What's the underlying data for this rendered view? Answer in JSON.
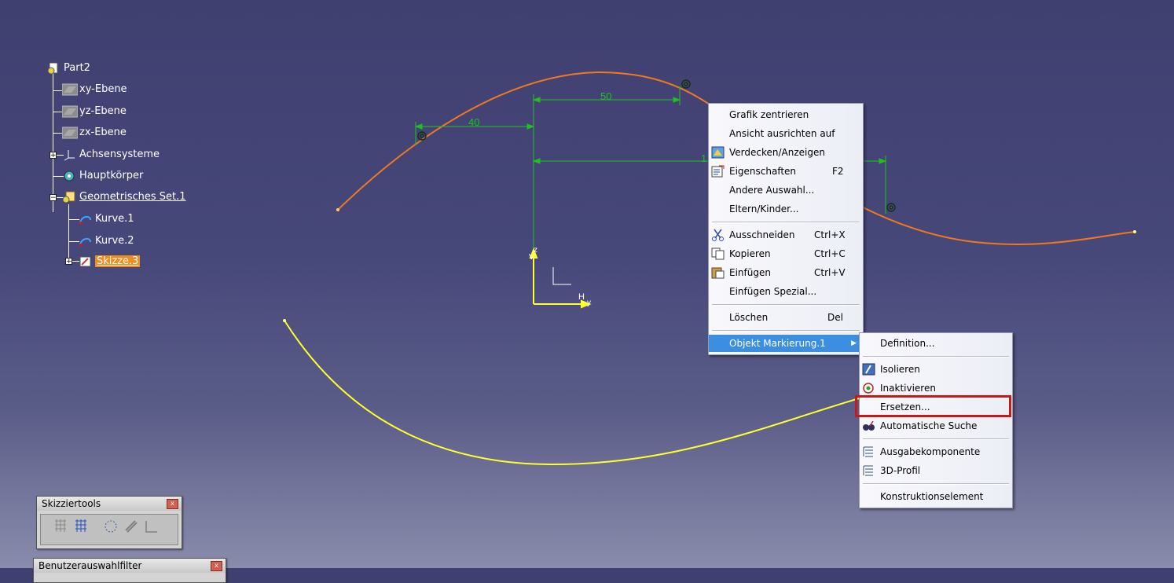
{
  "tree": {
    "root": "Part2",
    "items": [
      {
        "label": "xy-Ebene",
        "icon": "plane-icon"
      },
      {
        "label": "yz-Ebene",
        "icon": "plane-icon"
      },
      {
        "label": "zx-Ebene",
        "icon": "plane-icon"
      },
      {
        "label": "Achsensysteme",
        "icon": "axis-system-icon"
      },
      {
        "label": "Hauptkörper",
        "icon": "body-gear-icon"
      },
      {
        "label": "Geometrisches Set.1",
        "icon": "geometrical-set-icon"
      },
      {
        "label": "Kurve.1",
        "icon": "curve-icon"
      },
      {
        "label": "Kurve.2",
        "icon": "curve-icon"
      },
      {
        "label": "Skizze.3",
        "icon": "sketch-icon"
      }
    ]
  },
  "sketch": {
    "dim_40": "40",
    "dim_50": "50",
    "dim_1": "1",
    "axis_v": "V",
    "axis_z": "z",
    "axis_h": "H",
    "axis_y": "y"
  },
  "context_menu": {
    "items": [
      {
        "label": "Grafik zentrieren",
        "shortcut": ""
      },
      {
        "label": "Ansicht ausrichten auf",
        "shortcut": ""
      },
      {
        "label": "Verdecken/Anzeigen",
        "shortcut": ""
      },
      {
        "label": "Eigenschaften",
        "shortcut": "F2"
      },
      {
        "label": "Andere Auswahl...",
        "shortcut": ""
      },
      {
        "label": "Eltern/Kinder...",
        "shortcut": ""
      },
      {
        "label": "Ausschneiden",
        "shortcut": "Ctrl+X"
      },
      {
        "label": "Kopieren",
        "shortcut": "Ctrl+C"
      },
      {
        "label": "Einfügen",
        "shortcut": "Ctrl+V"
      },
      {
        "label": "Einfügen Spezial...",
        "shortcut": ""
      },
      {
        "label": "Löschen",
        "shortcut": "Del"
      },
      {
        "label": "Objekt Markierung.1",
        "shortcut": ""
      }
    ]
  },
  "submenu": {
    "items": [
      {
        "label": "Definition..."
      },
      {
        "label": "Isolieren"
      },
      {
        "label": "Inaktivieren"
      },
      {
        "label": "Ersetzen..."
      },
      {
        "label": "Automatische Suche"
      },
      {
        "label": "Ausgabekomponente"
      },
      {
        "label": "3D-Profil"
      },
      {
        "label": "Konstruktionselement"
      }
    ]
  },
  "toolbar_sketch": {
    "title": "Skizziertools",
    "close": "x"
  },
  "toolbar_filter": {
    "title": "Benutzerauswahlfilter",
    "close": "x"
  },
  "colors": {
    "curve_orange": "#f07820",
    "curve_yellow": "#ffff30",
    "dimension_green": "#20c020",
    "highlight": "#3c8ee0",
    "red_box": "#c81818"
  }
}
